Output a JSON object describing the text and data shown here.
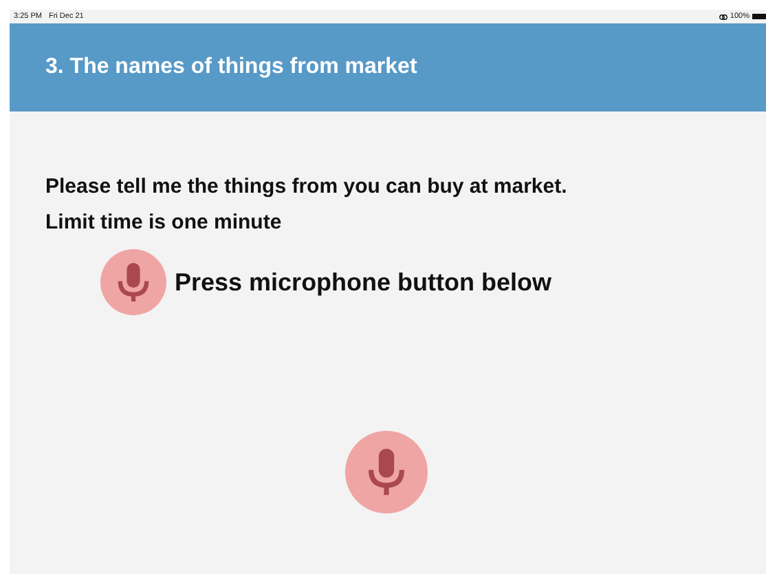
{
  "status_bar": {
    "time": "3:25 PM",
    "date": "Fri Dec 21",
    "battery": "100%"
  },
  "header": {
    "title": "3. The names of things from market"
  },
  "instructions": [
    "Please tell me the things from you can buy at market.",
    "Limit time is one minute"
  ],
  "hint": {
    "text": "Press microphone button below"
  }
}
